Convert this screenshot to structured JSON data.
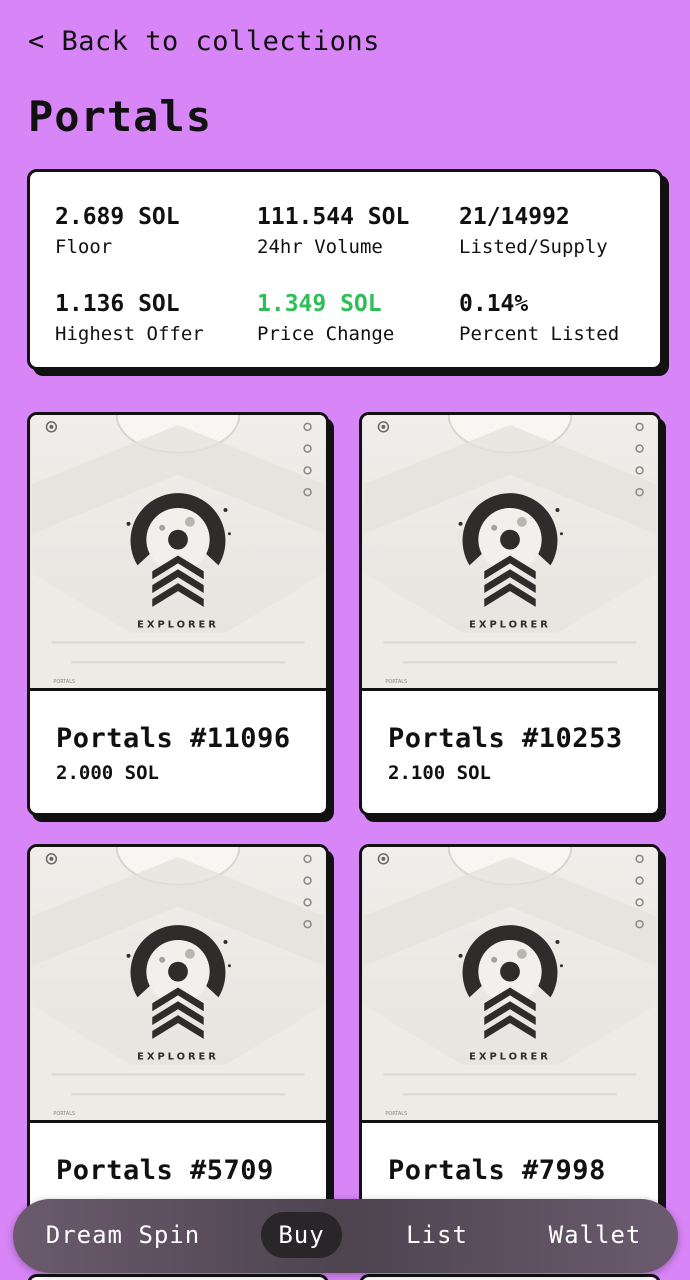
{
  "header": {
    "back_label": "< Back to collections",
    "title": "Portals"
  },
  "stats": [
    {
      "value": "2.689 SOL",
      "label": "Floor"
    },
    {
      "value": "111.544 SOL",
      "label": "24hr Volume"
    },
    {
      "value": "21/14992",
      "label": "Listed/Supply"
    },
    {
      "value": "1.136 SOL",
      "label": "Highest Offer"
    },
    {
      "value": "1.349 SOL",
      "label": "Price Change",
      "color": "#2dbe56"
    },
    {
      "value": "0.14%",
      "label": "Percent Listed"
    }
  ],
  "nfts": [
    {
      "name": "Portals #11096",
      "price": "2.000 SOL",
      "image_text": "EXPLORER",
      "watermark": "PORTALS"
    },
    {
      "name": "Portals #10253",
      "price": "2.100 SOL",
      "image_text": "EXPLORER",
      "watermark": "PORTALS"
    },
    {
      "name": "Portals #5709",
      "price": "",
      "image_text": "EXPLORER",
      "watermark": "PORTALS"
    },
    {
      "name": "Portals #7998",
      "price": "",
      "image_text": "EXPLORER",
      "watermark": "PORTALS"
    }
  ],
  "nav": {
    "items": [
      "Dream Spin",
      "Buy",
      "List",
      "Wallet"
    ],
    "active": "Buy"
  },
  "colors": {
    "background": "#d886f7",
    "positive": "#2dbe56",
    "nav_active": "#2a2528"
  }
}
